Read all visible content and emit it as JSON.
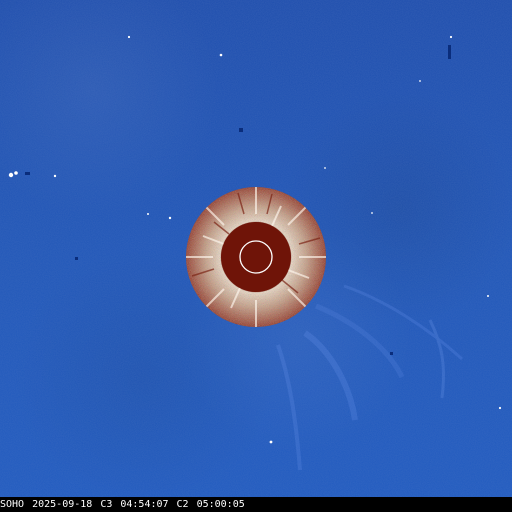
{
  "image": {
    "caption": {
      "mission": "SOHO",
      "date": "2025-09-18",
      "instrument_1": "C3",
      "time_1": "04:54:07",
      "instrument_2": "C2",
      "time_2": "05:00:05"
    },
    "colors": {
      "background": "#1f56b8",
      "disk": "#6f1408",
      "ring_light": "#e7d3c2",
      "ring_dark": "#8f2b1d",
      "sun_outline": "#ffffff"
    }
  }
}
